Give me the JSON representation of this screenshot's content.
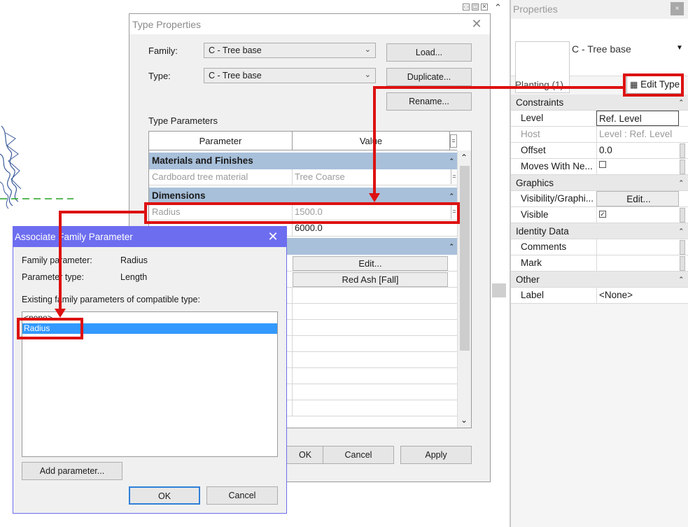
{
  "window_controls": [
    "▭",
    "◫",
    "✕"
  ],
  "scroll_up_glyph": "⌃",
  "type_properties": {
    "title": "Type Properties",
    "family_label": "Family:",
    "family_value": "C - Tree base",
    "type_label": "Type:",
    "type_value": "C - Tree base",
    "load_button": "Load...",
    "duplicate_button": "Duplicate...",
    "rename_button": "Rename...",
    "section_label": "Type Parameters",
    "columns": [
      "Parameter",
      "Value"
    ],
    "groups": {
      "materials": "Materials and Finishes",
      "dimensions": "Dimensions"
    },
    "rows": {
      "material_name": "Cardboard tree material",
      "material_value": "Tree Coarse",
      "radius_name": "Radius",
      "radius_value": "1500.0",
      "height_value": "6000.0",
      "edit_button": "Edit...",
      "red_ash": "Red Ash [Fall]"
    },
    "ok_button": "OK",
    "cancel_button": "Cancel",
    "apply_button": "Apply"
  },
  "properties": {
    "title": "Properties",
    "close_glyph": "×",
    "family_name": "C - Tree base",
    "selector_text": "Planting (1)",
    "edit_type_button": "Edit Type",
    "sections": {
      "constraints": "Constraints",
      "graphics": "Graphics",
      "identity": "Identity Data",
      "other": "Other"
    },
    "rows": {
      "level_k": "Level",
      "level_v": "Ref. Level",
      "host_k": "Host",
      "host_v": "Level : Ref. Level",
      "offset_k": "Offset",
      "offset_v": "0.0",
      "moves_k": "Moves With Ne...",
      "visgraph_k": "Visibility/Graphi...",
      "visgraph_v": "Edit...",
      "visible_k": "Visible",
      "comments_k": "Comments",
      "mark_k": "Mark",
      "label_k": "Label",
      "label_v": "<None>"
    },
    "visible_checked": true,
    "moves_checked": false
  },
  "associate_dialog": {
    "title": "Associate Family Parameter",
    "family_param_label": "Family parameter:",
    "family_param_value": "Radius",
    "param_type_label": "Parameter type:",
    "param_type_value": "Length",
    "existing_label": "Existing family parameters of compatible type:",
    "list_items": [
      "<none>",
      "Radius"
    ],
    "selected_item": "Radius",
    "add_parameter_button": "Add parameter...",
    "ok_button": "OK",
    "cancel_button": "Cancel"
  },
  "colors": {
    "annotation_red": "#dd1111",
    "selection_blue": "#3399ff",
    "group_header_blue": "#a8c0da",
    "dialog_title_blue": "#6d6df0"
  }
}
